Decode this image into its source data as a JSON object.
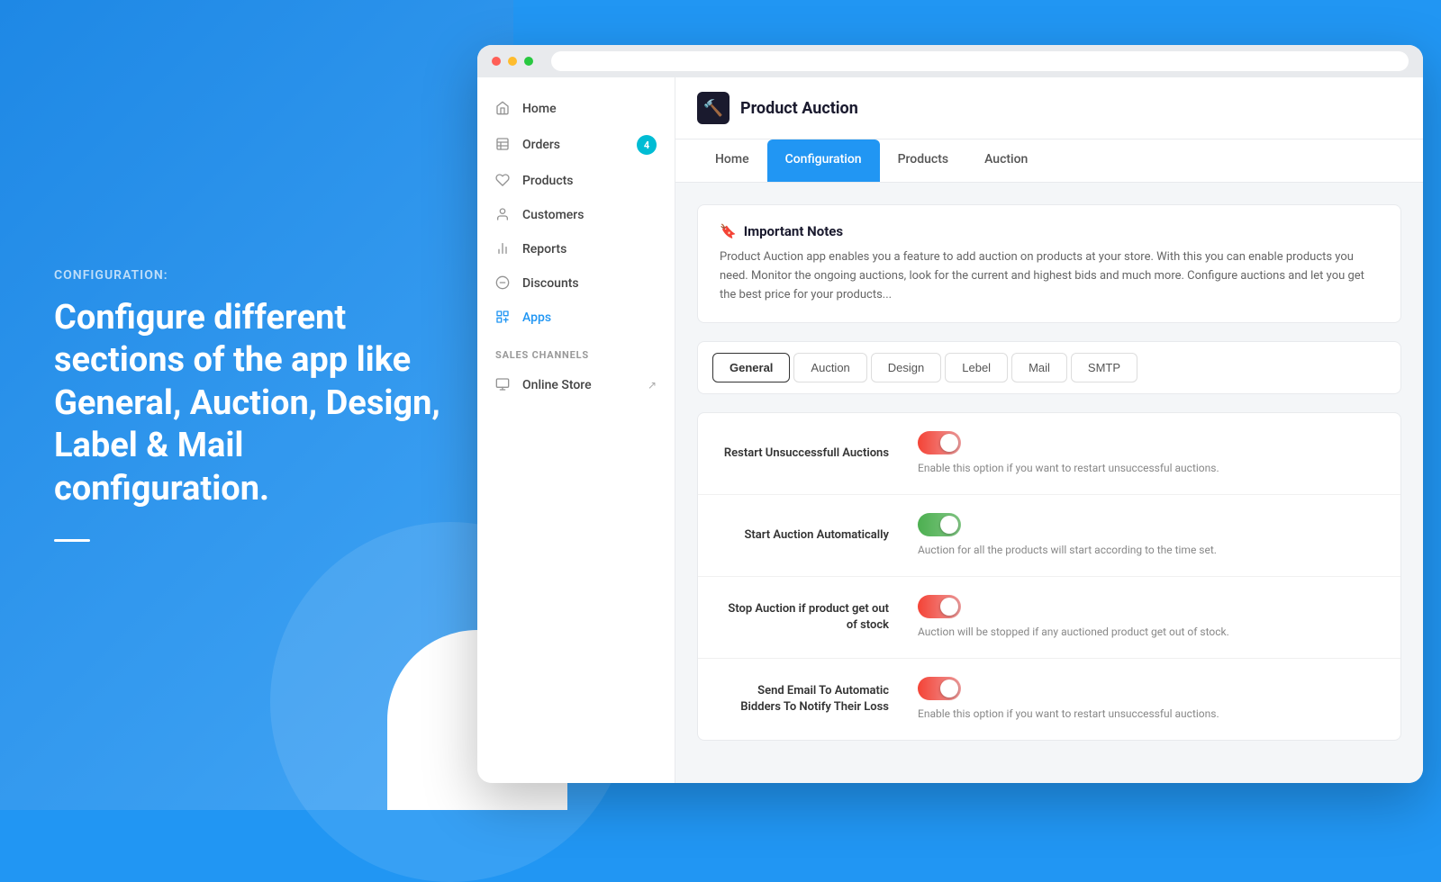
{
  "left": {
    "config_label": "CONFIGURATION:",
    "config_description": "Configure different sections of the app like General, Auction, Design, Label & Mail configuration."
  },
  "sidebar": {
    "items": [
      {
        "id": "home",
        "label": "Home",
        "icon": "home"
      },
      {
        "id": "orders",
        "label": "Orders",
        "icon": "orders",
        "badge": "4"
      },
      {
        "id": "products",
        "label": "Products",
        "icon": "products"
      },
      {
        "id": "customers",
        "label": "Customers",
        "icon": "customers"
      },
      {
        "id": "reports",
        "label": "Reports",
        "icon": "reports"
      },
      {
        "id": "discounts",
        "label": "Discounts",
        "icon": "discounts"
      },
      {
        "id": "apps",
        "label": "Apps",
        "icon": "apps",
        "active": true
      }
    ],
    "sales_channels_label": "SALES CHANNELS",
    "online_store": "Online Store"
  },
  "header": {
    "title": "Product Auction",
    "icon": "🔨"
  },
  "nav_tabs": [
    {
      "id": "home",
      "label": "Home"
    },
    {
      "id": "configuration",
      "label": "Configuration",
      "active": true
    },
    {
      "id": "products",
      "label": "Products"
    },
    {
      "id": "auction",
      "label": "Auction"
    }
  ],
  "notes": {
    "title": "Important Notes",
    "icon": "🔖",
    "text": "Product Auction app enables you a feature to add auction on products at your store. With this you can enable products you need. Monitor the ongoing auctions, look for the current and highest bids and much more. Configure auctions and let you get the best price for your products..."
  },
  "config_tabs": [
    {
      "id": "general",
      "label": "General",
      "active": true
    },
    {
      "id": "auction",
      "label": "Auction"
    },
    {
      "id": "design",
      "label": "Design"
    },
    {
      "id": "label",
      "label": "Lebel"
    },
    {
      "id": "mail",
      "label": "Mail"
    },
    {
      "id": "smtp",
      "label": "SMTP"
    }
  ],
  "settings": [
    {
      "id": "restart-unsuccessful",
      "label": "Restart Unsuccessfull Auctions",
      "toggle": "on-red",
      "desc": "Enable this option if you want to restart unsuccessful auctions."
    },
    {
      "id": "start-automatically",
      "label": "Start Auction Automatically",
      "toggle": "on-green",
      "desc": "Auction for all the products will start according to the time set."
    },
    {
      "id": "stop-out-of-stock",
      "label": "Stop Auction if product get out of stock",
      "toggle": "on-red",
      "desc": "Auction will be stopped if any auctioned product get out of stock."
    },
    {
      "id": "send-email",
      "label": "Send Email To Automatic Bidders To Notify Their Loss",
      "toggle": "on-red",
      "desc": "Enable this option if you want to restart unsuccessful auctions."
    }
  ]
}
